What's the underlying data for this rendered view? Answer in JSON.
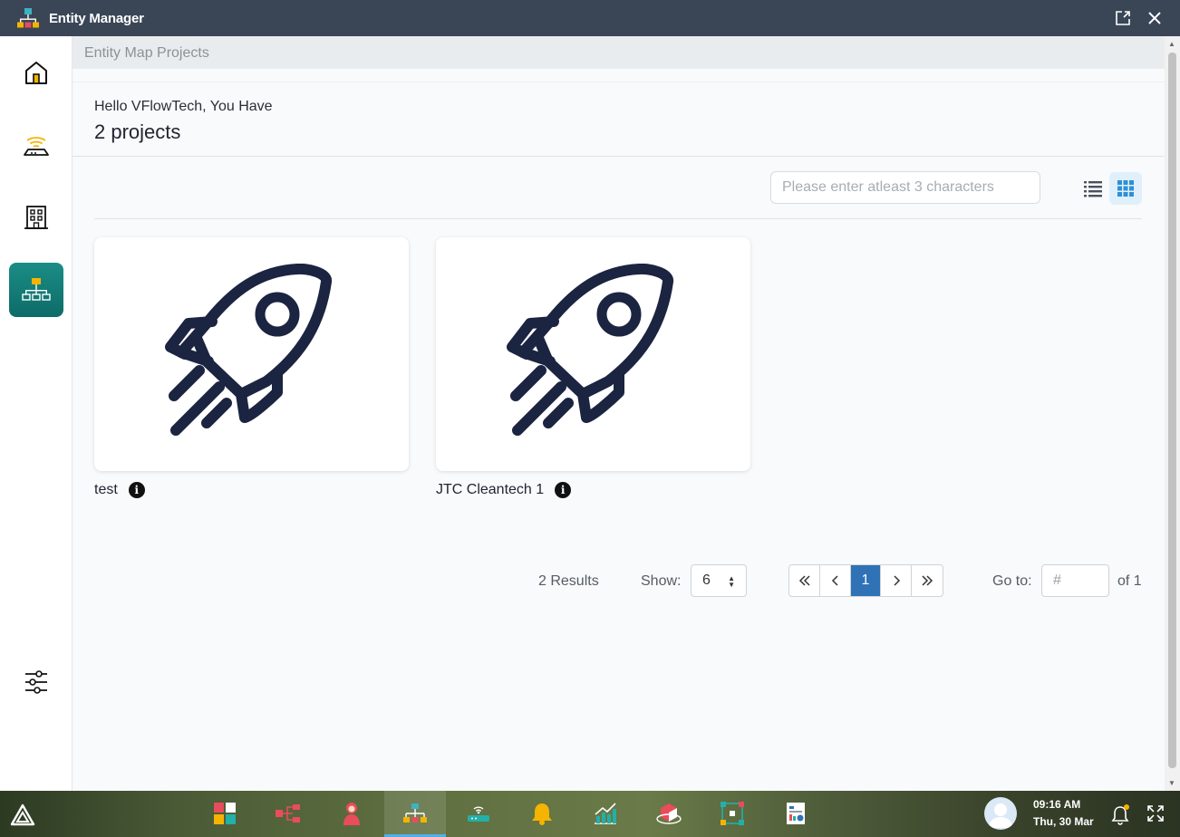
{
  "window": {
    "title": "Entity Manager"
  },
  "breadcrumb": "Entity Map Projects",
  "greeting": {
    "hello": "Hello VFlowTech, You Have",
    "count": "2 projects"
  },
  "search": {
    "placeholder": "Please enter atleast 3 characters"
  },
  "projects": [
    {
      "name": "test",
      "icon": "rocket-icon"
    },
    {
      "name": "JTC Cleantech 1",
      "icon": "rocket-icon"
    }
  ],
  "pagination": {
    "results": "2 Results",
    "show_label": "Show:",
    "show_value": "6",
    "current_page": "1",
    "goto_label": "Go to:",
    "goto_placeholder": "#",
    "of_label": "of 1"
  },
  "sidebar": {
    "items": [
      "home-icon",
      "router-icon",
      "building-icon",
      "entity-map-icon",
      "settings-sliders-icon"
    ],
    "active": "entity-map-icon"
  },
  "taskbar": {
    "time": "09:16 AM",
    "date": "Thu, 30 Mar"
  },
  "colors": {
    "titlebar": "#3a4656",
    "accent_teal": "#0d6b68",
    "page_active_blue": "#2f72b6",
    "rocket": "#1b2440"
  }
}
